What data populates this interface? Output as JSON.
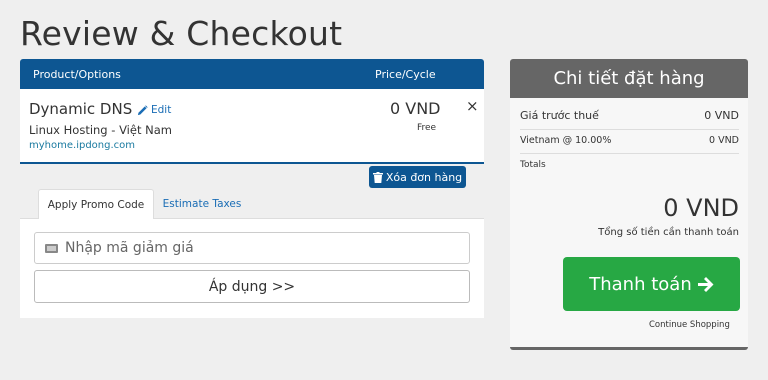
{
  "page": {
    "title": "Review & Checkout"
  },
  "cart": {
    "header": {
      "product_label": "Product/Options",
      "price_label": "Price/Cycle"
    },
    "items": [
      {
        "name": "Dynamic DNS",
        "edit_label": "Edit",
        "group": "Linux Hosting - Việt Nam",
        "domain": "myhome.ipdong.com",
        "price": "0 VND",
        "cycle": "Free",
        "remove_symbol": "×"
      }
    ],
    "empty_cart_label": "Xóa đơn hàng"
  },
  "promo": {
    "tabs": [
      {
        "label": "Apply Promo Code",
        "active": true
      },
      {
        "label": "Estimate Taxes",
        "active": false
      }
    ],
    "input_placeholder": "Nhập mã giảm giá",
    "apply_label": "Áp dụng >>"
  },
  "summary": {
    "title": "Chi tiết đặt hàng",
    "subtotal_label": "Giá trước thuế",
    "subtotal_value": "0 VND",
    "tax_label": "Vietnam @ 10.00%",
    "tax_value": "0 VND",
    "totals_label": "Totals",
    "total_amount": "0 VND",
    "total_note": "Tổng số tiền cần thanh toán",
    "checkout_label": "Thanh toán",
    "continue_label": "Continue Shopping"
  },
  "icons": {
    "edit": "pencil-icon",
    "remove": "close-icon",
    "empty": "trash-icon",
    "promo": "ticket-icon",
    "checkout": "arrow-right-icon"
  },
  "colors": {
    "brand_blue": "#0d5692",
    "link_blue": "#1a6db5",
    "checkout_green": "#27a844",
    "summary_header": "#666666",
    "background": "#efefef"
  }
}
